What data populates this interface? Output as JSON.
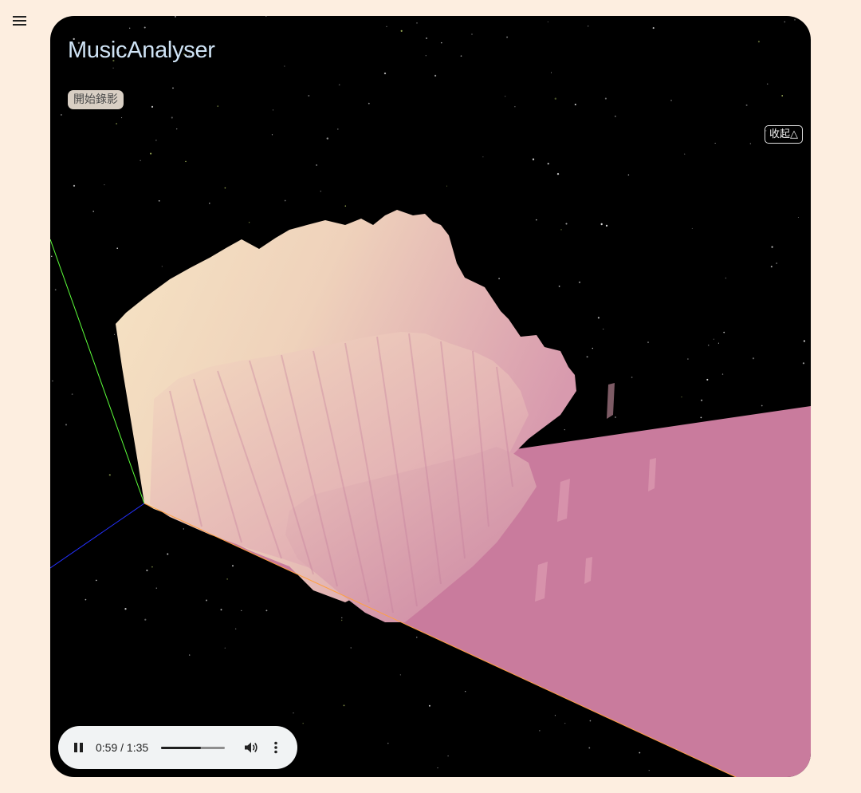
{
  "app": {
    "title": "MusicAnalyser"
  },
  "toolbar": {
    "record_label": "開始錄影",
    "collapse_label": "收起△"
  },
  "player": {
    "current_time": "0:59",
    "duration": "1:35",
    "time_display": "0:59 / 1:35",
    "progress": 0.62
  },
  "colors": {
    "page_background": "#fdeee0",
    "scene_background": "#000000",
    "floor_pink": "#c97b9d",
    "peak_cream": "#f5e2bc",
    "mid_pink": "#dcaab4",
    "axis_x": "#ffa040",
    "axis_y": "#5cff3a",
    "axis_z": "#2430ff"
  },
  "icons": [
    "menu-icon",
    "pause-icon",
    "volume-icon",
    "more-options-icon"
  ]
}
